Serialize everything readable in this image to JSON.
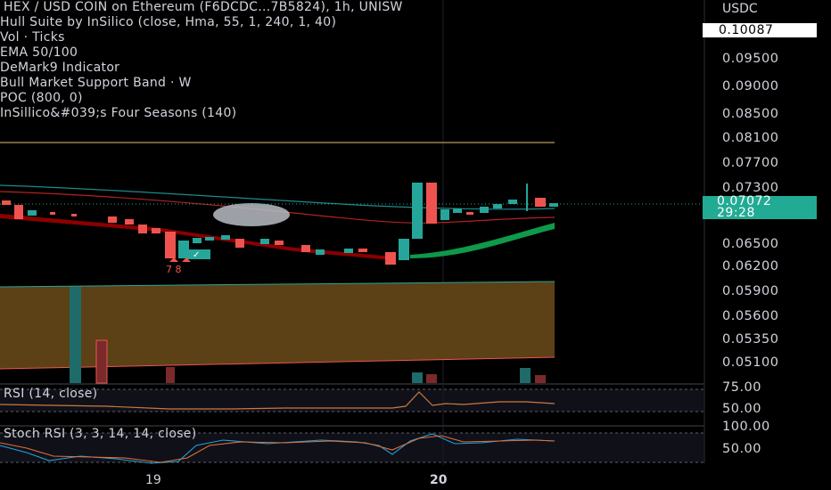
{
  "legend": {
    "title": "HEX / USD COIN on Ethereum (F6DCDC...7B5824), 1h, UNISW",
    "indicators": [
      "Hull Suite by InSilico (close, Hma, 55, 1, 240, 1, 40)",
      "Vol · Ticks",
      "EMA 50/100",
      "DeMark9 Indicator",
      "Bull Market Support Band · W",
      "POC (800, 0)",
      "InSillico&#039;s Four Seasons (140)"
    ]
  },
  "price_axis": {
    "currency": "USDC",
    "top_price": "0.10087",
    "current_price": "0.07072",
    "countdown": "29:28",
    "ticks": [
      "0.09500",
      "0.09000",
      "0.08500",
      "0.08100",
      "0.07700",
      "0.07300",
      "0.06500",
      "0.06200",
      "0.05900",
      "0.05600",
      "0.05350",
      "0.05100"
    ]
  },
  "rsi": {
    "label": "RSI (14, close)",
    "ticks": [
      "75.00",
      "50.00"
    ]
  },
  "stoch": {
    "label": "Stoch RSI (3, 3, 14, 14, close)",
    "ticks": [
      "100.00",
      "50.00"
    ]
  },
  "demark_label": "7 8",
  "time_axis": [
    "19",
    "20"
  ],
  "colors": {
    "up": "#26a69a",
    "down": "#ef5350",
    "band_fill": "#5c4016",
    "rsi_line": "#c97a3c",
    "stoch_k": "#1fa1d8",
    "stoch_d": "#e0703a"
  }
}
